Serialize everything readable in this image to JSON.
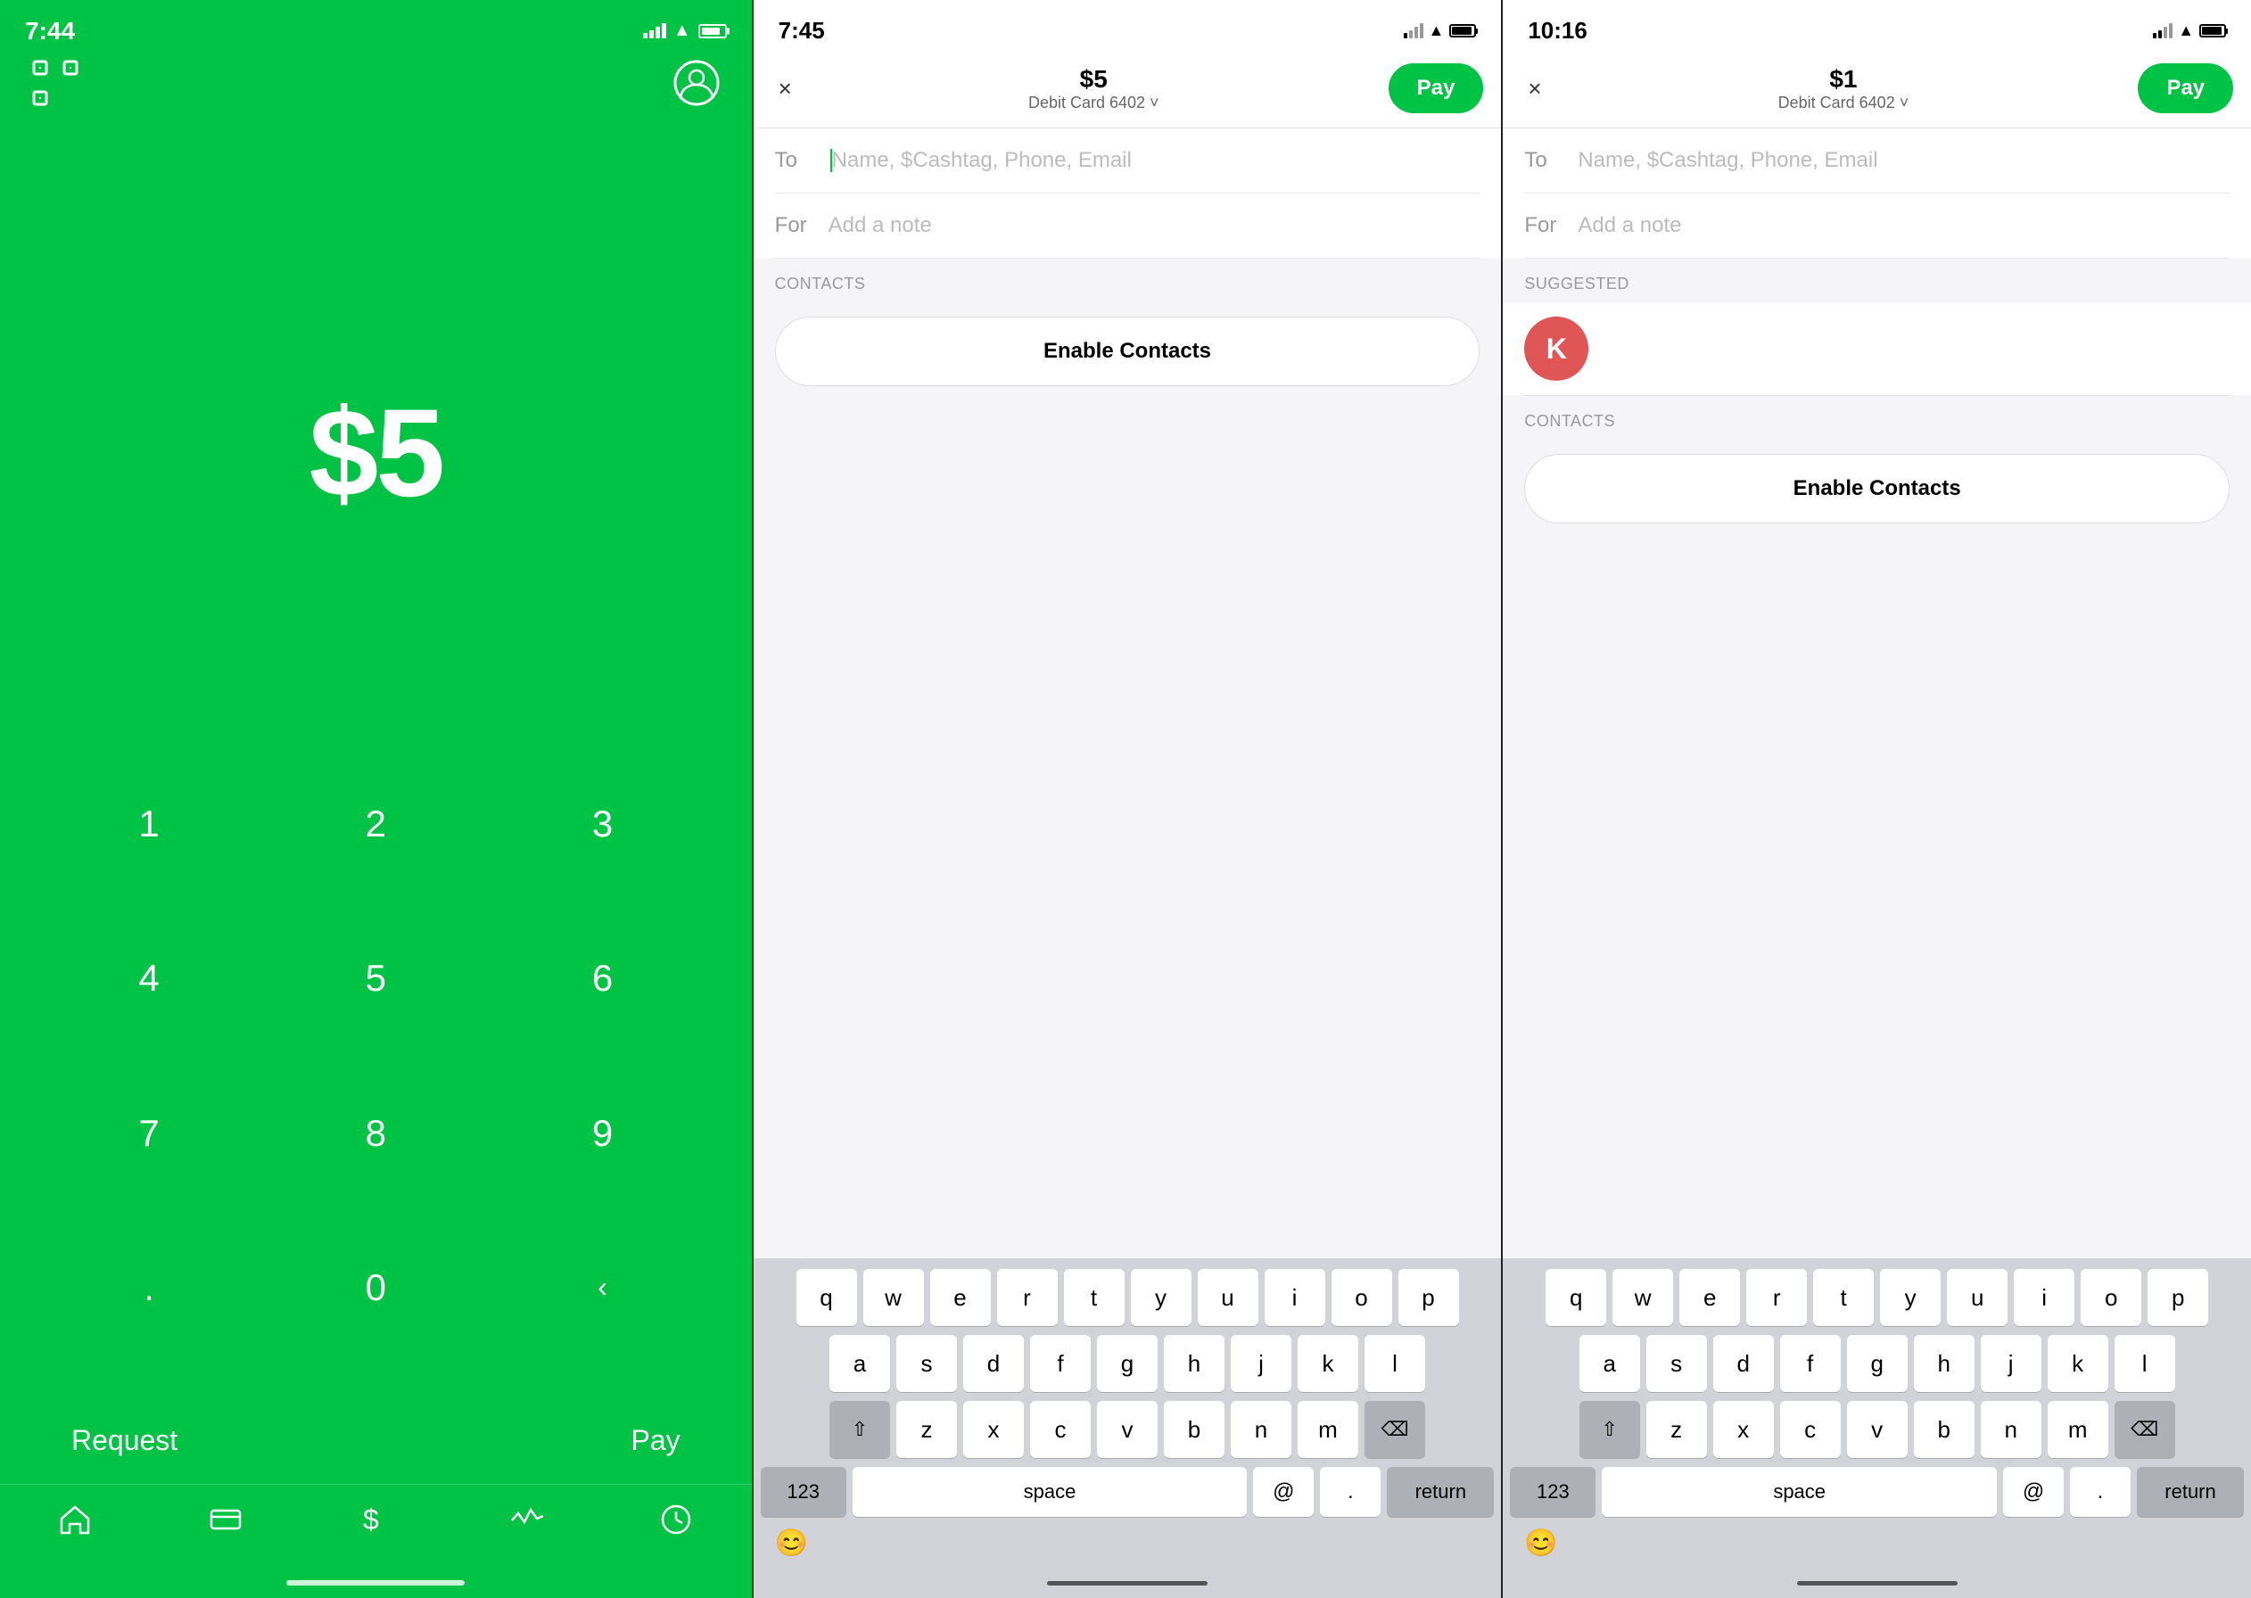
{
  "screen1": {
    "time": "7:44",
    "amount": "$5",
    "keys": [
      "1",
      "2",
      "3",
      "4",
      "5",
      "6",
      "7",
      "8",
      "9",
      ".",
      "0",
      "⌫"
    ],
    "request_label": "Request",
    "pay_label": "Pay"
  },
  "screen2": {
    "time": "7:45",
    "header_amount": "$5",
    "card_info": "Debit Card 6402 ˅",
    "pay_label": "Pay",
    "close_label": "×",
    "to_label": "To",
    "to_placeholder": "Name, $Cashtag, Phone, Email",
    "for_label": "For",
    "for_placeholder": "Add a note",
    "contacts_header": "CONTACTS",
    "enable_contacts_label": "Enable Contacts",
    "keyboard": {
      "rows": [
        [
          "q",
          "w",
          "e",
          "r",
          "t",
          "y",
          "u",
          "i",
          "o",
          "p"
        ],
        [
          "a",
          "s",
          "d",
          "f",
          "g",
          "h",
          "j",
          "k",
          "l"
        ],
        [
          "z",
          "x",
          "c",
          "v",
          "b",
          "n",
          "m"
        ],
        [
          "123",
          "space",
          "@",
          ".",
          "return"
        ]
      ],
      "shift_label": "⇧",
      "delete_label": "⌫",
      "emoji_label": "😊"
    }
  },
  "screen3": {
    "time": "10:16",
    "header_amount": "$1",
    "card_info": "Debit Card 6402 ˅",
    "pay_label": "Pay",
    "close_label": "×",
    "to_label": "To",
    "to_placeholder": "Name, $Cashtag, Phone, Email",
    "for_label": "For",
    "for_placeholder": "Add a note",
    "suggested_header": "SUGGESTED",
    "contact_initial": "K",
    "contacts_header": "CONTACTS",
    "enable_contacts_label": "Enable Contacts",
    "keyboard": {
      "rows": [
        [
          "q",
          "w",
          "e",
          "r",
          "t",
          "y",
          "u",
          "i",
          "o",
          "p"
        ],
        [
          "a",
          "s",
          "d",
          "f",
          "g",
          "h",
          "j",
          "k",
          "l"
        ],
        [
          "z",
          "x",
          "c",
          "v",
          "b",
          "n",
          "m"
        ],
        [
          "123",
          "space",
          "@",
          ".",
          "return"
        ]
      ],
      "shift_label": "⇧",
      "delete_label": "⌫",
      "emoji_label": "😊"
    }
  },
  "colors": {
    "green": "#00C244",
    "white": "#ffffff",
    "dark": "#000000",
    "gray": "#999999",
    "light_bg": "#f5f5f7",
    "keyboard_bg": "#d1d3d9",
    "key_bg": "#ffffff",
    "key_special_bg": "#adb0b7"
  }
}
